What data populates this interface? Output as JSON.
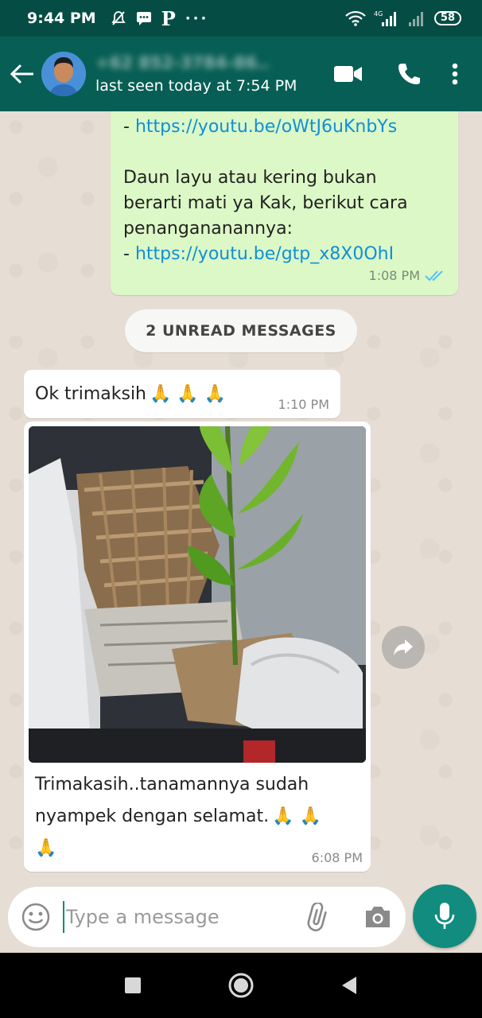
{
  "status_bar": {
    "time": "9:44 PM",
    "network": "4G",
    "battery": "58"
  },
  "header": {
    "contact_name": "+62 852-3784-86..",
    "last_seen": "last seen today at 7:54 PM"
  },
  "messages": {
    "outgoing": {
      "line1_prefix": "- ",
      "link1": "https://youtu.be/oWtJ6uKnbYs",
      "line2": "Daun layu atau kering bukan",
      "line3": "berarti mati ya Kak, berikut cara",
      "line4": "penangananannya:",
      "line5_prefix": "- ",
      "link2": "https://youtu.be/gtp_x8X0OhI",
      "time": "1:08 PM"
    },
    "unread_label": "2 UNREAD MESSAGES",
    "incoming_1": {
      "text": "Ok trimaksih",
      "emoji": "🙏 🙏 🙏",
      "time": "1:10 PM"
    },
    "incoming_2": {
      "caption_line1": "Trimakasih..tanamannya sudah",
      "caption_line2": "nyampek dengan selamat.",
      "caption_emoji_1": "🙏 🙏",
      "caption_emoji_2": "🙏",
      "time": "6:08 PM"
    }
  },
  "input": {
    "placeholder": "Type a message"
  },
  "colors": {
    "header": "#075e54",
    "status_bar": "#054d44",
    "outgoing_bubble": "#dcf8c6",
    "link": "#0f8fd8",
    "read_ticks": "#4fc3f7",
    "mic_button": "#128c7e"
  }
}
